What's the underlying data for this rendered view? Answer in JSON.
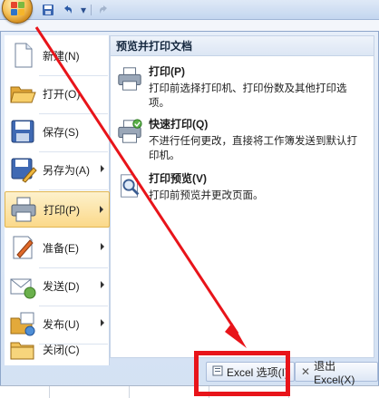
{
  "quick_access": {
    "items": [
      "save-icon",
      "undo-icon",
      "redo-icon"
    ]
  },
  "menu": {
    "items": [
      {
        "label": "新建(N)",
        "icon": "new-document-icon",
        "has_submenu": false
      },
      {
        "label": "打开(O)",
        "icon": "open-folder-icon",
        "has_submenu": false
      },
      {
        "label": "保存(S)",
        "icon": "save-icon",
        "has_submenu": false
      },
      {
        "label": "另存为(A)",
        "icon": "save-as-icon",
        "has_submenu": true
      },
      {
        "label": "打印(P)",
        "icon": "printer-icon",
        "has_submenu": true,
        "selected": true
      },
      {
        "label": "准备(E)",
        "icon": "prepare-icon",
        "has_submenu": true
      },
      {
        "label": "发送(D)",
        "icon": "send-icon",
        "has_submenu": true
      },
      {
        "label": "发布(U)",
        "icon": "publish-icon",
        "has_submenu": true
      },
      {
        "label": "关闭(C)",
        "icon": "close-folder-icon",
        "has_submenu": false
      }
    ]
  },
  "submenu": {
    "title": "预览并打印文档",
    "items": [
      {
        "title": "打印(P)",
        "desc": "打印前选择打印机、打印份数及其他打印选项。",
        "icon": "printer-icon"
      },
      {
        "title": "快速打印(Q)",
        "desc": "不进行任何更改，直接将工作簿发送到默认打印机。",
        "icon": "quick-print-icon"
      },
      {
        "title": "打印预览(V)",
        "desc": "打印前预览并更改页面。",
        "icon": "print-preview-icon"
      }
    ]
  },
  "footer": {
    "options_label": "Excel 选项(I)",
    "exit_label": "退出 Excel(X)"
  },
  "colors": {
    "accent": "#e8141a",
    "selection": "#fbd98a",
    "panel": "#d3e1f3"
  }
}
